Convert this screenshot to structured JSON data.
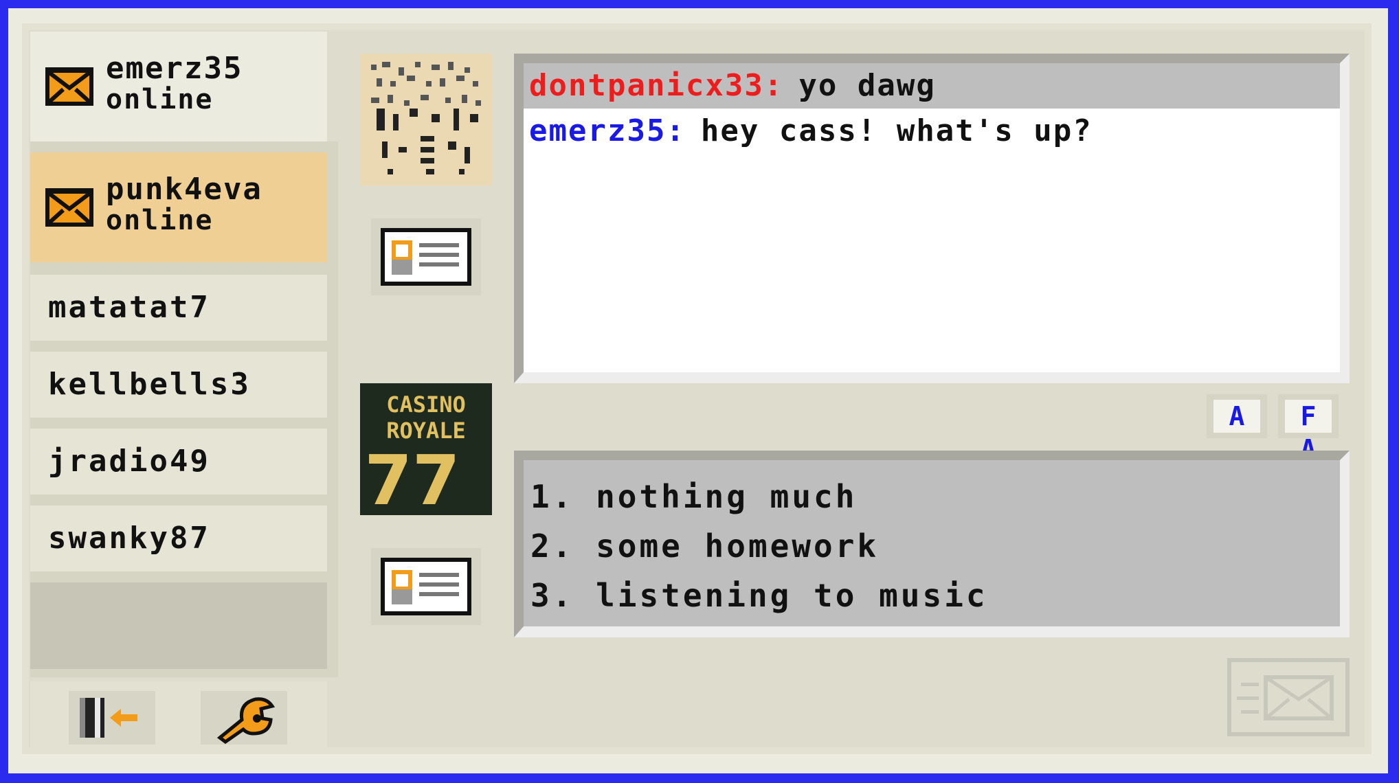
{
  "current_user": {
    "name": "emerz35",
    "status": "online"
  },
  "active_contact": {
    "name": "punk4eva",
    "status": "online"
  },
  "contacts": [
    {
      "name": "matatat7"
    },
    {
      "name": "kellbells3"
    },
    {
      "name": "jradio49"
    },
    {
      "name": "swanky87"
    }
  ],
  "avatars": [
    {
      "name": "static-avatar"
    },
    {
      "name": "casino-royale-avatar",
      "lines": [
        "CASINO",
        "ROYALE",
        "77"
      ]
    }
  ],
  "chat": {
    "messages": [
      {
        "user": "dontpanicx33:",
        "text": "yo dawg",
        "color": "#ee1d1d",
        "selected": true
      },
      {
        "user": "emerz35:",
        "text": "hey cass! what's up?",
        "color": "#1a1ae6",
        "selected": false
      }
    ]
  },
  "format_buttons": {
    "font_glyph": "A",
    "size_glyph": "F A"
  },
  "replies": [
    {
      "text": "1. nothing much"
    },
    {
      "text": "2. some homework"
    },
    {
      "text": "3. listening to music"
    }
  ],
  "colors": {
    "background": "#2b2bf0",
    "active_contact": "#efcf93",
    "accent_orange": "#f39c1a"
  }
}
